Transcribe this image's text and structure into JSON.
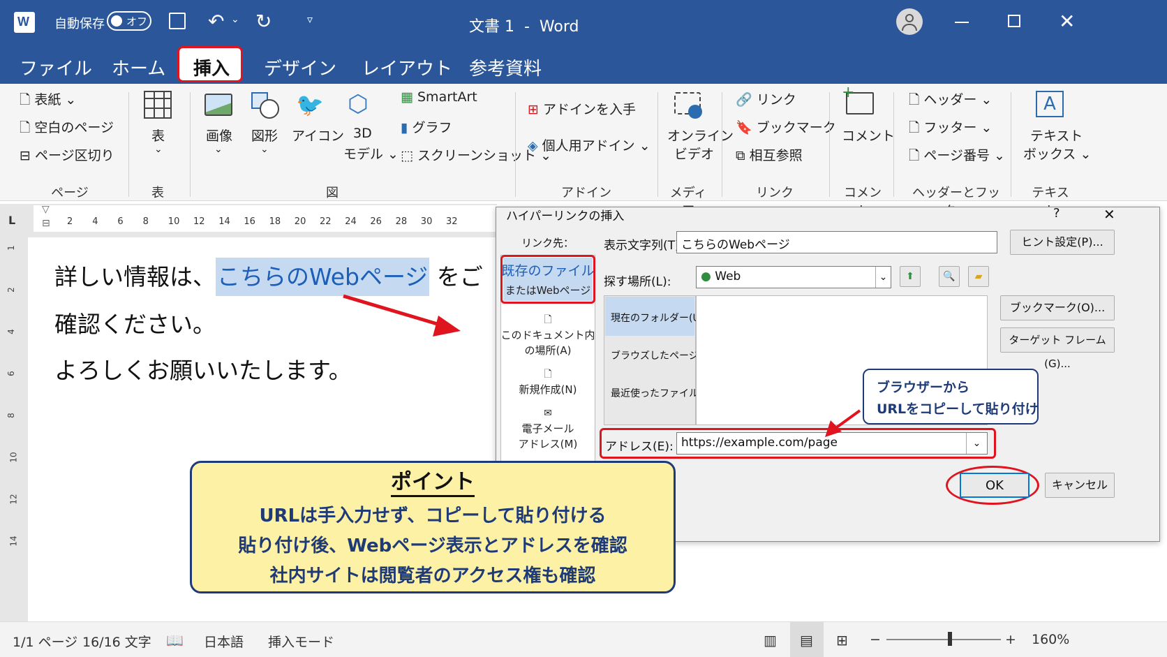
{
  "titlebar": {
    "autosave_label": "自動保存",
    "autosave_toggle": "オフ",
    "title": "文書 1  -  Word"
  },
  "tabs": [
    "ファイル",
    "ホーム",
    "挿入",
    "デザイン",
    "レイアウト",
    "参考資料"
  ],
  "active_tab": "挿入",
  "ribbon": {
    "page_group": {
      "items": [
        "表紙",
        "空白のページ",
        "ページ区切り"
      ],
      "label": "ページ"
    },
    "table_group": {
      "button": "表",
      "label": "表"
    },
    "illust_group": {
      "picture": "画像",
      "shapes": "図形",
      "icons": "アイコン",
      "model3d_1": "3D",
      "model3d_2": "モデル",
      "smartart": "SmartArt",
      "chart": "グラフ",
      "screenshot": "スクリーンショット",
      "label": "図"
    },
    "addin_group": {
      "get": "アドインを入手",
      "personal": "個人用アドイン",
      "label": "アドイン"
    },
    "media_group": {
      "video_1": "オンライン",
      "video_2": "ビデオ",
      "label": "メディア"
    },
    "link_group": {
      "link": "リンク",
      "bookmark": "ブックマーク",
      "crossref": "相互参照",
      "label": "リンク"
    },
    "comment_group": {
      "comment": "コメント",
      "label": "コメント"
    },
    "hf_group": {
      "header": "ヘッダー",
      "footer": "フッター",
      "pagenum": "ページ番号",
      "label": "ヘッダーとフッター"
    },
    "text_group": {
      "textbox_1": "テキスト",
      "textbox_2": "ボックス",
      "label": "テキスト"
    }
  },
  "ruler": [
    "2",
    "4",
    "6",
    "8",
    "10",
    "12",
    "14",
    "16",
    "18",
    "20",
    "22",
    "24",
    "26",
    "28",
    "30",
    "32"
  ],
  "vruler": [
    "1",
    "2",
    "4",
    "6",
    "8",
    "10",
    "12",
    "14"
  ],
  "document": {
    "line1_pre": "詳しい情報は、",
    "line1_link": "こちらのWebページ",
    "line1_post": "をご",
    "line2": "確認ください。",
    "line3": "よろしくお願いいたします。"
  },
  "dialog": {
    "title": "ハイパーリンクの挿入",
    "help": "?",
    "link_to": "リンク先：",
    "left": {
      "existing_1": "既存のファイル",
      "existing_2": "またはWebページ",
      "place_1": "このドキュメント内",
      "place_2": "の場所(A)",
      "new": "新規作成(N)",
      "email_1": "電子メール",
      "email_2": "アドレス(M)"
    },
    "display_text_label": "表示文字列(T):",
    "display_text_value": "こちらのWebページ",
    "screentip_button": "ヒント設定(P)...",
    "look_in_label": "探す場所(L):",
    "look_in_value": "Web",
    "browse_items": [
      "現在のフォルダー(U)",
      "ブラウズしたページ(B)",
      "最近使ったファイル(C)"
    ],
    "bookmark_button": "ブックマーク(O)...",
    "target_frame_button": "ターゲット フレーム(G)...",
    "address_label": "アドレス(E):",
    "address_value": "https://example.com/page",
    "ok": "OK",
    "cancel": "キャンセル"
  },
  "callout": {
    "line1": "ブラウザーから",
    "line2": "URLをコピーして貼り付け"
  },
  "point": {
    "title": "ポイント",
    "lines": [
      "URLは手入力せず、コピーして貼り付ける",
      "貼り付け後、Webページ表示とアドレスを確認",
      "社内サイトは閲覧者のアクセス権も確認"
    ]
  },
  "status": {
    "page": "1/1 ページ",
    "words": "16/16 文字",
    "lang": "日本語",
    "mode": "挿入モード",
    "zoom": "160%",
    "minus": "−",
    "plus": "+"
  },
  "colors": {
    "word_blue": "#2b579a",
    "highlight": "#e0141e",
    "note_bg": "#fdf1a6",
    "note_border": "#1f3b77"
  }
}
